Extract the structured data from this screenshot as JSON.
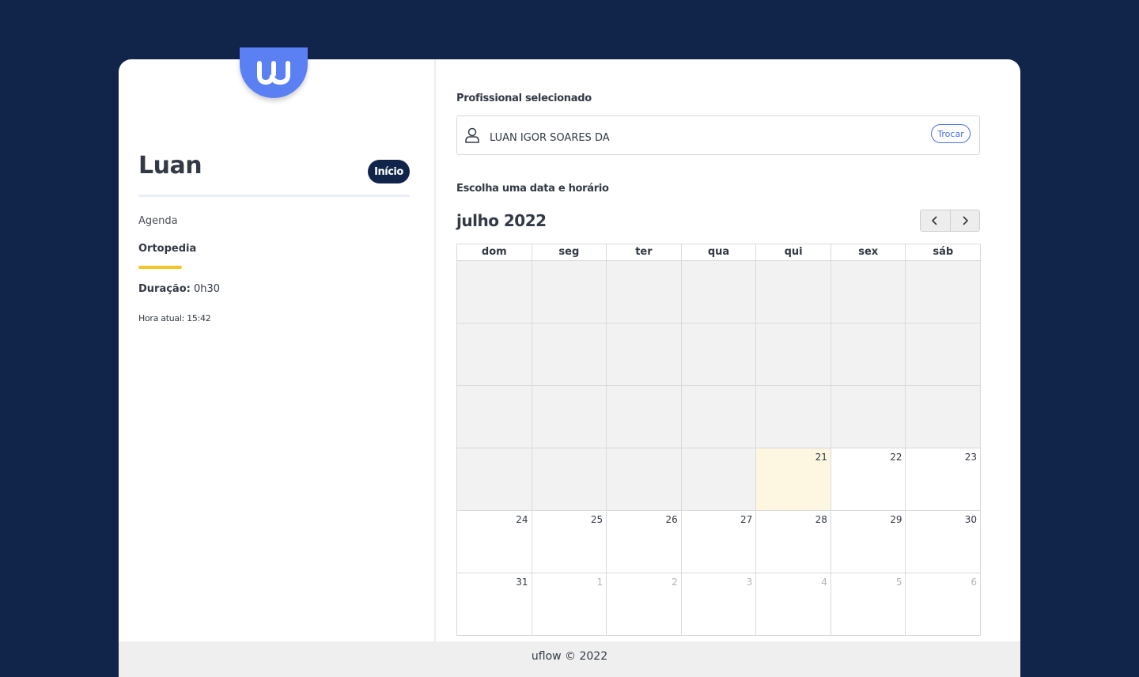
{
  "logo": {
    "icon": "uflow-w-logo"
  },
  "sidebar": {
    "user_name": "Luan",
    "home_button": "Início",
    "agenda_label": "Agenda",
    "specialty": "Ortopedia",
    "duration_label": "Duração:",
    "duration_value": "0h30",
    "current_time": "Hora atual: 15:42"
  },
  "main": {
    "professional_label": "Profissional selecionado",
    "professional_name": "LUAN IGOR SOARES DA",
    "change_button": "Trocar",
    "datetime_label": "Escolha uma data e horário",
    "month_title": "julho 2022",
    "weekdays": [
      "dom",
      "seg",
      "ter",
      "qua",
      "qui",
      "sex",
      "sáb"
    ],
    "weeks": [
      [
        {
          "d": "",
          "s": "disabled"
        },
        {
          "d": "",
          "s": "disabled"
        },
        {
          "d": "",
          "s": "disabled"
        },
        {
          "d": "",
          "s": "disabled"
        },
        {
          "d": "",
          "s": "disabled"
        },
        {
          "d": "",
          "s": "disabled"
        },
        {
          "d": "",
          "s": "disabled"
        }
      ],
      [
        {
          "d": "",
          "s": "disabled"
        },
        {
          "d": "",
          "s": "disabled"
        },
        {
          "d": "",
          "s": "disabled"
        },
        {
          "d": "",
          "s": "disabled"
        },
        {
          "d": "",
          "s": "disabled"
        },
        {
          "d": "",
          "s": "disabled"
        },
        {
          "d": "",
          "s": "disabled"
        }
      ],
      [
        {
          "d": "",
          "s": "disabled"
        },
        {
          "d": "",
          "s": "disabled"
        },
        {
          "d": "",
          "s": "disabled"
        },
        {
          "d": "",
          "s": "disabled"
        },
        {
          "d": "",
          "s": "disabled"
        },
        {
          "d": "",
          "s": "disabled"
        },
        {
          "d": "",
          "s": "disabled"
        }
      ],
      [
        {
          "d": "",
          "s": "disabled"
        },
        {
          "d": "",
          "s": "disabled"
        },
        {
          "d": "",
          "s": "disabled"
        },
        {
          "d": "",
          "s": "disabled"
        },
        {
          "d": "21",
          "s": "today"
        },
        {
          "d": "22",
          "s": "available"
        },
        {
          "d": "23",
          "s": "available"
        }
      ],
      [
        {
          "d": "24",
          "s": "available"
        },
        {
          "d": "25",
          "s": "available"
        },
        {
          "d": "26",
          "s": "available"
        },
        {
          "d": "27",
          "s": "available"
        },
        {
          "d": "28",
          "s": "available"
        },
        {
          "d": "29",
          "s": "available"
        },
        {
          "d": "30",
          "s": "available"
        }
      ],
      [
        {
          "d": "31",
          "s": "available"
        },
        {
          "d": "1",
          "s": "other"
        },
        {
          "d": "2",
          "s": "other"
        },
        {
          "d": "3",
          "s": "other"
        },
        {
          "d": "4",
          "s": "other"
        },
        {
          "d": "5",
          "s": "other"
        },
        {
          "d": "6",
          "s": "other"
        }
      ]
    ]
  },
  "footer": {
    "text": "uflow © 2022"
  },
  "colors": {
    "background": "#11254a",
    "brand": "#5b80f3",
    "accent_yellow": "#f2c52a",
    "today_bg": "#fdf7e1",
    "disabled_bg": "#f2f2f2"
  }
}
